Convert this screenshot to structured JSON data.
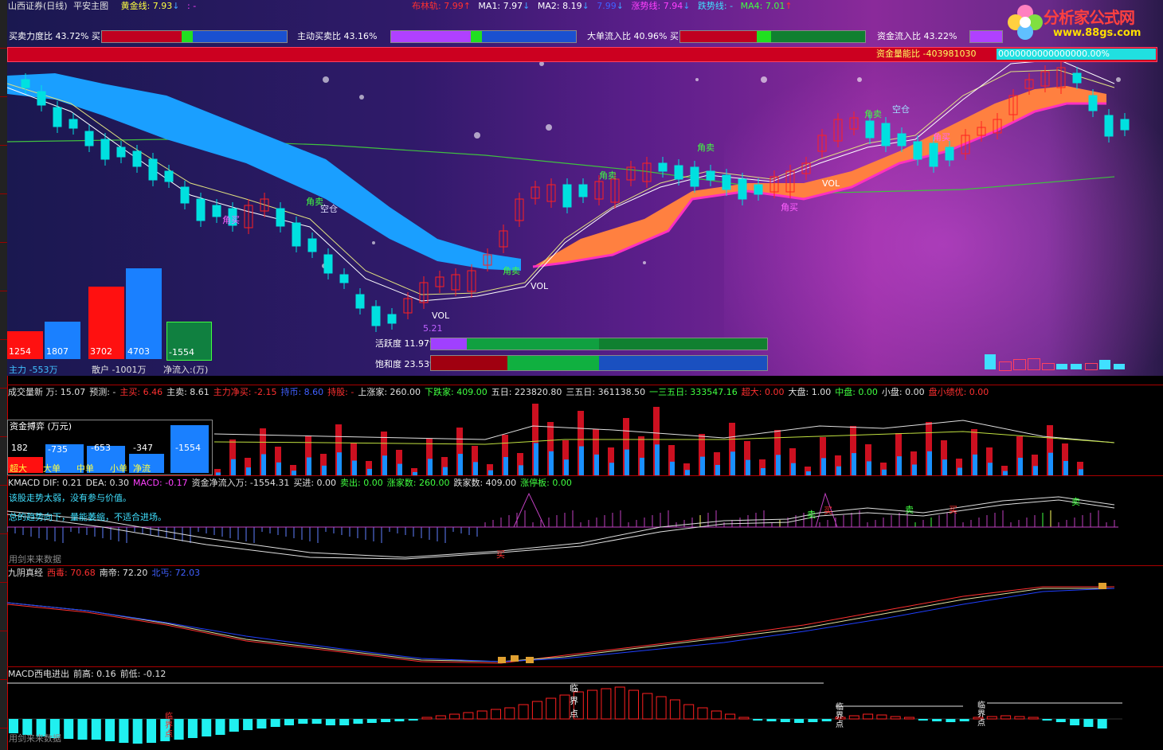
{
  "header": {
    "broker": "山西证券(日线)",
    "broker_en": "Shanxi Securities (Daily)",
    "chart_name": "平安主图",
    "chart_name_en": "Ping An Main Chart",
    "gold_line": "黄金线: 7.93",
    "gold_line_en": "Golden line",
    "blank": ": -",
    "boll": "布林轨: 7.99",
    "ma1": "MA1: 7.97",
    "ma2": "MA2: 8.19",
    "ma3": "7.99",
    "rise_line": "涨势线: 7.94",
    "rise_line_en": "Uptrend line",
    "fall_line": "跌势线: -",
    "fall_line_en": "Downtrend line",
    "ma4": "MA4: 7.01"
  },
  "logo": {
    "title": "分析家公式网",
    "title_en": "Analyst Formula Network",
    "url": "www.88gs.com"
  },
  "ratio_bars": {
    "buy_sell_force": "买卖力度比 43.72% 买",
    "buy_sell_force_en": "Buy/sell force ratio 43.72% Buy",
    "active_buy_sell": "主动买卖比 43.16%",
    "active_buy_sell_en": "Active buy/sell ratio 43.16%",
    "big_order_inflow": "大单流入比 40.96% 买",
    "big_order_inflow_en": "Large-order inflow ratio 40.96% Buy",
    "fund_inflow": "资金流入比 43.22%",
    "fund_inflow_en": "Capital inflow ratio 43.22%",
    "fund_energy": "资金量能比 -403981030",
    "fund_energy_en": "Capital volume-energy ratio -403981030",
    "fund_energy_value": "0000000000000000.00%"
  },
  "main_labels": {
    "jiao_buy": "角买",
    "jiao_buy_en": "Angle buy",
    "jiao_sell": "角卖",
    "jiao_sell_en": "Angle sell",
    "short_pos": "空仓",
    "short_pos_en": "Flat / no position",
    "vol": "VOL",
    "low_price": "5.21"
  },
  "money_bars": {
    "values": [
      "1254",
      "1807",
      "3702",
      "4703",
      "-1554"
    ],
    "heavy": "主力 -553万",
    "heavy_en": "Main force -5.53M",
    "retail": "散户 -1001万",
    "retail_en": "Retail -10.01M",
    "net": "净流入:(万)",
    "net_en": "Net inflow (10k)"
  },
  "gauges": {
    "activity": "活跃度 11.97%",
    "activity_en": "Activity 11.97%",
    "saturation": "饱和度 23.53%",
    "saturation_en": "Saturation 23.53%"
  },
  "volume_pane": {
    "stats": [
      {
        "t": "成交量新 万: 15.07",
        "c": "#e0e0e0"
      },
      {
        "t": "预测: -",
        "c": "#e0e0e0"
      },
      {
        "t": "主买: 6.46",
        "c": "#ff3030"
      },
      {
        "t": "主卖: 8.61",
        "c": "#e0e0e0"
      },
      {
        "t": "主力净买: -2.15",
        "c": "#ff3030"
      },
      {
        "t": "持币: 8.60",
        "c": "#4060ff"
      },
      {
        "t": "持股: -",
        "c": "#ff3030"
      },
      {
        "t": "上涨家: 260.00",
        "c": "#e0e0e0"
      },
      {
        "t": "下跌家: 409.00",
        "c": "#40ff40"
      },
      {
        "t": "五日: 223820.80",
        "c": "#e0e0e0"
      },
      {
        "t": "三五日: 361138.50",
        "c": "#e0e0e0"
      },
      {
        "t": "一三五日: 333547.16",
        "c": "#40ff40"
      },
      {
        "t": "超大: 0.00",
        "c": "#ff3030"
      },
      {
        "t": "大盘: 1.00",
        "c": "#e0e0e0"
      },
      {
        "t": "中盘: 0.00",
        "c": "#40ff40"
      },
      {
        "t": "小盘: 0.00",
        "c": "#e0e0e0"
      },
      {
        "t": "盘小绩优: 0.00",
        "c": "#ff3030"
      }
    ],
    "stats_en": "Volume 10k: 15.07 | Forecast: - | Main buy: 6.46 | Main sell: 8.61 | Main net buy: -2.15 | Holding cash: 8.60 | Holding shares: - | Advancers: 260.00 | Decliners: 409.00 | 5-day: 223820.80 | 3/5-day: 361138.50 | 1/3/5-day: 333547.16 | Extra-large: 0.00 | Large cap: 1.00 | Mid cap: 0.00 | Small cap: 0.00 | Small-cap quality: 0.00",
    "box_title": "资金搏弈 (万元)",
    "box_title_en": "Capital contest (10k CNY)",
    "box_values": [
      "182",
      "-735",
      "-653",
      "-347",
      "-1554"
    ],
    "box_labels": [
      "超大",
      "大单",
      "中单",
      "小单",
      "净流"
    ],
    "box_labels_en": [
      "Extra-large",
      "Large orders",
      "Medium orders",
      "Small orders",
      "Net flow"
    ]
  },
  "kmacd_pane": {
    "stats": [
      {
        "t": "KMACD DIF: 0.21",
        "c": "#e0e0e0"
      },
      {
        "t": "DEA: 0.30",
        "c": "#e0e0e0"
      },
      {
        "t": "MACD: -0.17",
        "c": "#ff40ff"
      },
      {
        "t": "资金净流入万: -1554.31",
        "c": "#e0e0e0"
      },
      {
        "t": "买进: 0.00",
        "c": "#e0e0e0"
      },
      {
        "t": "卖出: 0.00",
        "c": "#40ff40"
      },
      {
        "t": "涨家数: 260.00",
        "c": "#40ff40"
      },
      {
        "t": "跌家数: 409.00",
        "c": "#e0e0e0"
      },
      {
        "t": "涨停板: 0.00",
        "c": "#40ff40"
      }
    ],
    "stats_en": "KMACD DIF: 0.21 | DEA: 0.30 | MACD: -0.17 | Net capital inflow (10k): -1554.31 | Buy in: 0.00 | Sell out: 0.00 | Advancers: 260.00 | Decliners: 409.00 | Limit-up: 0.00",
    "msg1": "该股走势太弱，没有参与价值。",
    "msg1_en": "This stock's trend is too weak; not worth participating.",
    "msg2": "总的趋势向下，量能萎缩，不适合进场。",
    "msg2_en": "Overall trend is down and volume is shrinking; not suitable for entry.",
    "footer": "用剑来来数据",
    "footer_en": "Data via Jianlai",
    "buy_mark": "买",
    "buy_mark_en": "Buy",
    "sell_mark": "卖",
    "sell_mark_en": "Sell"
  },
  "jiuyin_pane": {
    "stats": [
      {
        "t": "九阴真经",
        "c": "#e0e0e0"
      },
      {
        "t": "西毒: 70.68",
        "c": "#ff3030"
      },
      {
        "t": "南帝: 72.20",
        "c": "#e0e0e0"
      },
      {
        "t": "北丐: 72.03",
        "c": "#4060ff"
      }
    ],
    "stats_en": "Nine Yin Manual | West Poison: 70.68 | South Emperor: 72.20 | North Beggar: 72.03"
  },
  "macd_pane": {
    "stats": [
      {
        "t": "MACD西电进出",
        "c": "#e0e0e0"
      },
      {
        "t": "前高: 0.16",
        "c": "#e0e0e0"
      },
      {
        "t": "前低: -0.12",
        "c": "#e0e0e0"
      }
    ],
    "stats_en": "MACD West-electric in/out | Prior high: 0.16 | Prior low: -0.12",
    "critical": "临界点",
    "critical_en": "Critical point",
    "footer": "用剑来来数据",
    "footer_en": "Data via Jianlai"
  },
  "colors": {
    "up": "#ff2020",
    "down": "#00e0e0",
    "ribbon_blue": "#1a9fff",
    "ribbon_orange": "#ff8040",
    "accent_red": "#cc0020"
  }
}
